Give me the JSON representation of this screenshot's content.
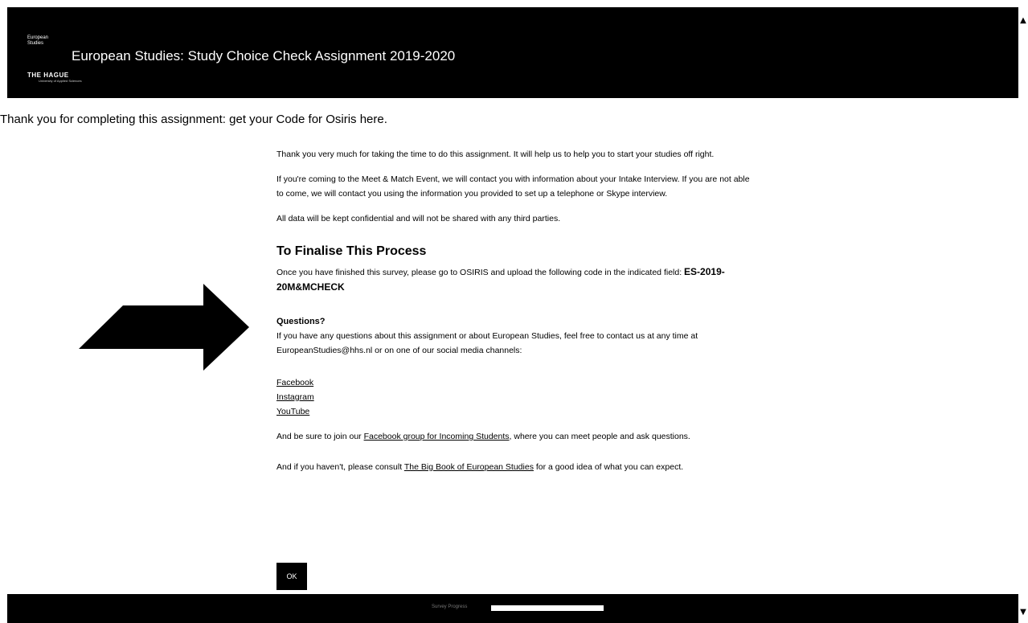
{
  "header": {
    "logo": {
      "line1": "European",
      "line2": "Studies",
      "line3": "THE HAGUE",
      "line4": "University of Applied Sciences"
    },
    "title": "European Studies: Study Choice Check Assignment 2019-2020"
  },
  "page_heading": "Thank you for completing this assignment: get your Code for Osiris here.",
  "content": {
    "para1": "Thank you very much for taking the time to do this assignment. It will help us to help you to start your studies off right.",
    "para2": "If you're coming to the Meet & Match Event, we will contact you with information about your Intake Interview. If you are not able to come, we will contact you using the information you provided to set up a telephone or Skype interview.",
    "para3": "All data will be kept confidential and will not be shared with any third parties.",
    "finalise_heading": "To Finalise This Process",
    "finalise_text": "Once you have finished this survey, please go to OSIRIS and upload the following code in the indicated field:",
    "code": "ES-2019-20M&MCHECK",
    "questions_heading": "Questions?",
    "questions_text": "If you have any questions about this assignment or about European Studies, feel free to contact us at any time at EuropeanStudies@hhs.nl or on one of our social media channels:",
    "social_links": [
      "Facebook",
      "Instagram",
      "YouTube"
    ],
    "join_prefix": "And be sure to join our ",
    "join_link": "Facebook group for Incoming Students",
    "join_suffix": ", where you can meet people and ask questions.",
    "consult_prefix": "And if you haven't, please consult ",
    "consult_link": "The Big Book of European Studies",
    "consult_suffix": " for a good idea of what you can expect."
  },
  "ok_label": "OK",
  "footer": {
    "progress_label": "Survey Progress",
    "progress_fraction": 1.0
  },
  "scrollbar": {
    "up_icon": "▲",
    "down_icon": "▼"
  },
  "colors": {
    "header_bg": "#000000",
    "button_bg": "#000000",
    "arrow": "#000000"
  }
}
